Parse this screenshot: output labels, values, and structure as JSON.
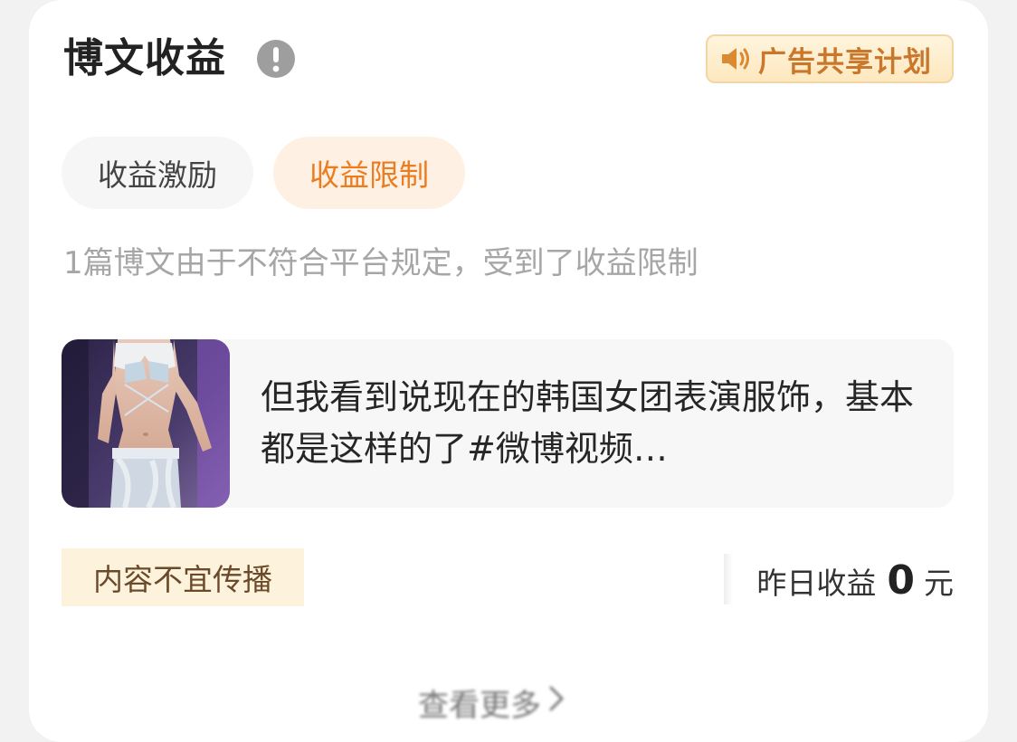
{
  "header": {
    "title": "博文收益",
    "info_icon": "exclamation-circle-icon",
    "ad_badge": {
      "icon": "speaker-icon",
      "label": "广告共享计划"
    }
  },
  "tabs": [
    {
      "label": "收益激励",
      "active": false
    },
    {
      "label": "收益限制",
      "active": true
    }
  ],
  "notice": "1篇博文由于不符合平台规定，受到了收益限制",
  "post": {
    "text": "但我看到说现在的韩国女团表演服饰，基本都是这样的了#微博视频…",
    "thumbnail_icon": "post-thumbnail"
  },
  "restriction_tag": "内容不宜传播",
  "earnings": {
    "label": "昨日收益",
    "amount": "0",
    "unit": "元"
  },
  "more_link": {
    "label": "查看更多",
    "icon": "chevron-right-icon"
  },
  "colors": {
    "accent_orange": "#ea7d1f",
    "badge_text": "#c9772b",
    "tag_bg": "#fdf3dd"
  }
}
